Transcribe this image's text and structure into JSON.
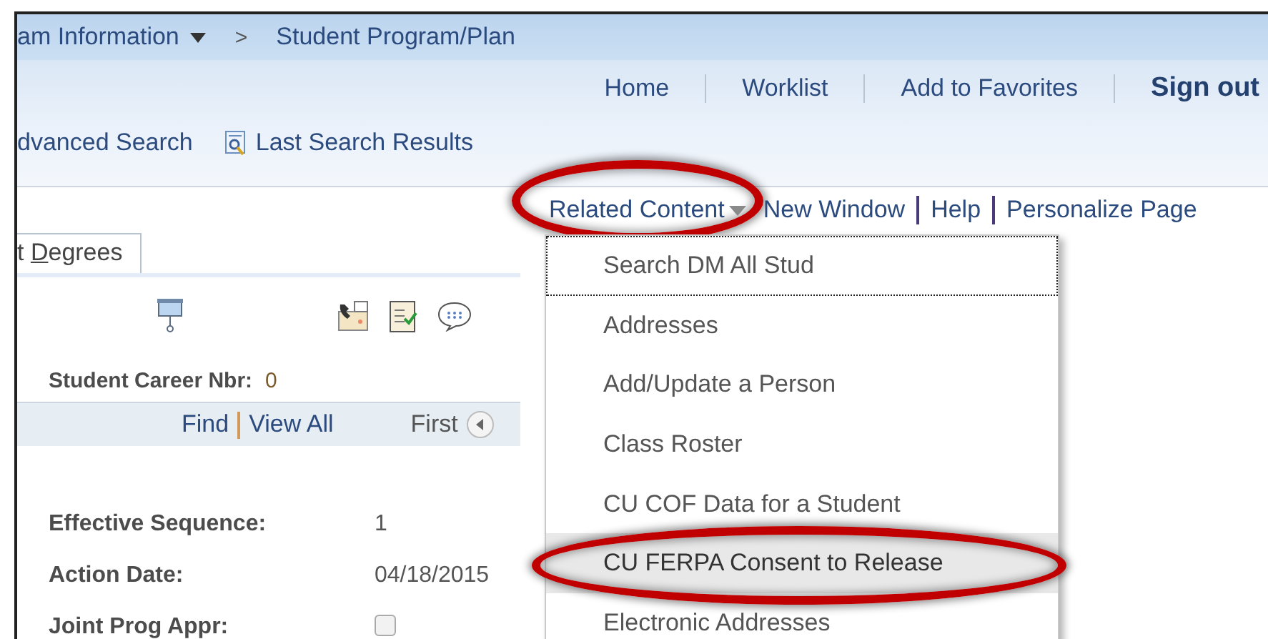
{
  "breadcrumb": {
    "separator": ">",
    "items": [
      {
        "label": "am Information",
        "has_menu": true
      },
      {
        "label": "Student Program/Plan",
        "has_menu": false
      }
    ]
  },
  "header_links": [
    {
      "label": "Home",
      "bold": false
    },
    {
      "label": "Worklist",
      "bold": false
    },
    {
      "label": "Add to Favorites",
      "bold": false
    },
    {
      "label": "Sign out",
      "bold": true
    }
  ],
  "search_links": [
    {
      "label": "dvanced Search",
      "kind": "text"
    },
    {
      "label": "Last Search Results",
      "kind": "icon"
    }
  ],
  "related_links": [
    {
      "label": "Related Content",
      "kind": "dropdown",
      "circled": true
    },
    {
      "label": "New Window",
      "kind": "link",
      "circled": false
    },
    {
      "label": "Help",
      "kind": "link",
      "circled": false
    },
    {
      "label": "Personalize Page",
      "kind": "link",
      "circled": false
    }
  ],
  "tabs": [
    {
      "before": "t ",
      "key": "D",
      "after": "egrees",
      "selected": true
    }
  ],
  "career": {
    "label": "Student Career Nbr:",
    "value": "0"
  },
  "grid_nav": {
    "find": "Find",
    "view_all": "View All",
    "first": "First"
  },
  "fields": [
    {
      "label": "Effective Sequence:",
      "kind": "text",
      "value": "1"
    },
    {
      "label": "Action Date:",
      "kind": "text",
      "value": "04/18/2015"
    },
    {
      "label": "Joint Prog Appr:",
      "kind": "checkbox",
      "checked": false
    }
  ],
  "menu": {
    "items": [
      {
        "label": "Search DM All Stud",
        "selected": false,
        "focused": true,
        "circled": false
      },
      {
        "label": "Addresses",
        "selected": false,
        "focused": false,
        "circled": false
      },
      {
        "label": "Add/Update a Person",
        "selected": false,
        "focused": false,
        "circled": false
      },
      {
        "label": "Class Roster",
        "selected": false,
        "focused": false,
        "circled": false
      },
      {
        "label": "CU COF Data for a Student",
        "selected": false,
        "focused": false,
        "circled": false
      },
      {
        "label": "CU FERPA Consent to Release",
        "selected": true,
        "focused": false,
        "circled": true
      },
      {
        "label": "Electronic Addresses",
        "selected": false,
        "focused": false,
        "circled": false
      }
    ]
  }
}
